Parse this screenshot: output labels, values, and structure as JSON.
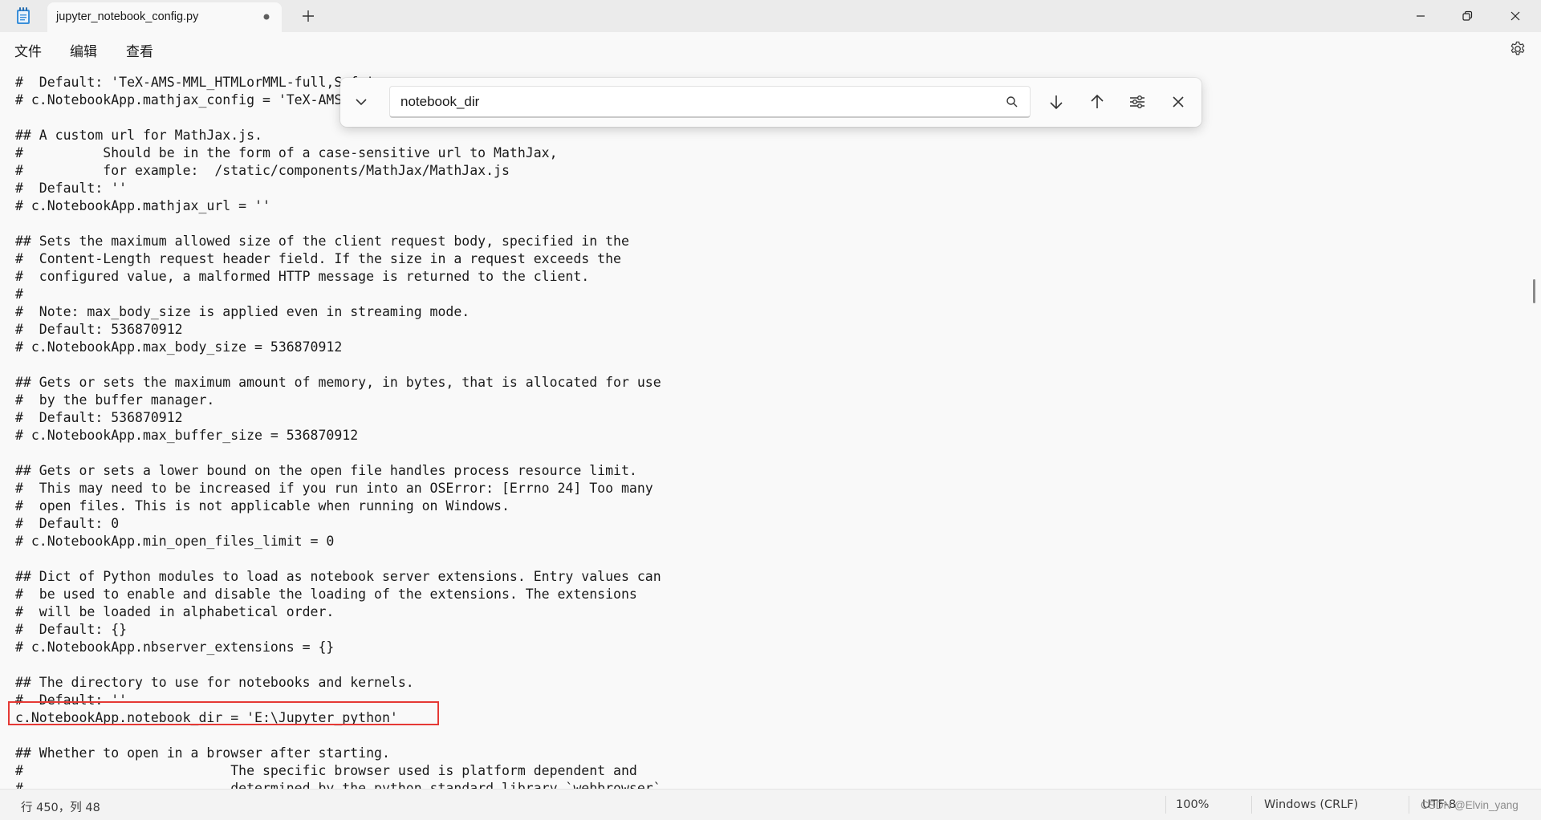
{
  "tab": {
    "title": "jupyter_notebook_config.py"
  },
  "menu": [
    "文件",
    "编辑",
    "查看"
  ],
  "find": {
    "query": "notebook_dir"
  },
  "code_lines": [
    "#  Default: 'TeX-AMS-MML_HTMLorMML-full,Safe'",
    "# c.NotebookApp.mathjax_config = 'TeX-AMS-MML_HTMLorMML-full,Safe'",
    "",
    "## A custom url for MathJax.js.",
    "#          Should be in the form of a case-sensitive url to MathJax,",
    "#          for example:  /static/components/MathJax/MathJax.js",
    "#  Default: ''",
    "# c.NotebookApp.mathjax_url = ''",
    "",
    "## Sets the maximum allowed size of the client request body, specified in the",
    "#  Content-Length request header field. If the size in a request exceeds the",
    "#  configured value, a malformed HTTP message is returned to the client.",
    "#",
    "#  Note: max_body_size is applied even in streaming mode.",
    "#  Default: 536870912",
    "# c.NotebookApp.max_body_size = 536870912",
    "",
    "## Gets or sets the maximum amount of memory, in bytes, that is allocated for use",
    "#  by the buffer manager.",
    "#  Default: 536870912",
    "# c.NotebookApp.max_buffer_size = 536870912",
    "",
    "## Gets or sets a lower bound on the open file handles process resource limit.",
    "#  This may need to be increased if you run into an OSError: [Errno 24] Too many",
    "#  open files. This is not applicable when running on Windows.",
    "#  Default: 0",
    "# c.NotebookApp.min_open_files_limit = 0",
    "",
    "## Dict of Python modules to load as notebook server extensions. Entry values can",
    "#  be used to enable and disable the loading of the extensions. The extensions",
    "#  will be loaded in alphabetical order.",
    "#  Default: {}",
    "# c.NotebookApp.nbserver_extensions = {}",
    "",
    "## The directory to use for notebooks and kernels.",
    "#  Default: ''",
    "c.NotebookApp.notebook_dir = 'E:\\Jupyter_python'",
    "",
    "## Whether to open in a browser after starting.",
    "#                          The specific browser used is platform dependent and",
    "#                          determined by the python standard library `webbrowser`"
  ],
  "status": {
    "position": "行 450，列 48",
    "zoom": "100%",
    "line_ending": "Windows (CRLF)",
    "encoding": "UTF-8",
    "watermark": "CSDN @Elvin_yang"
  }
}
